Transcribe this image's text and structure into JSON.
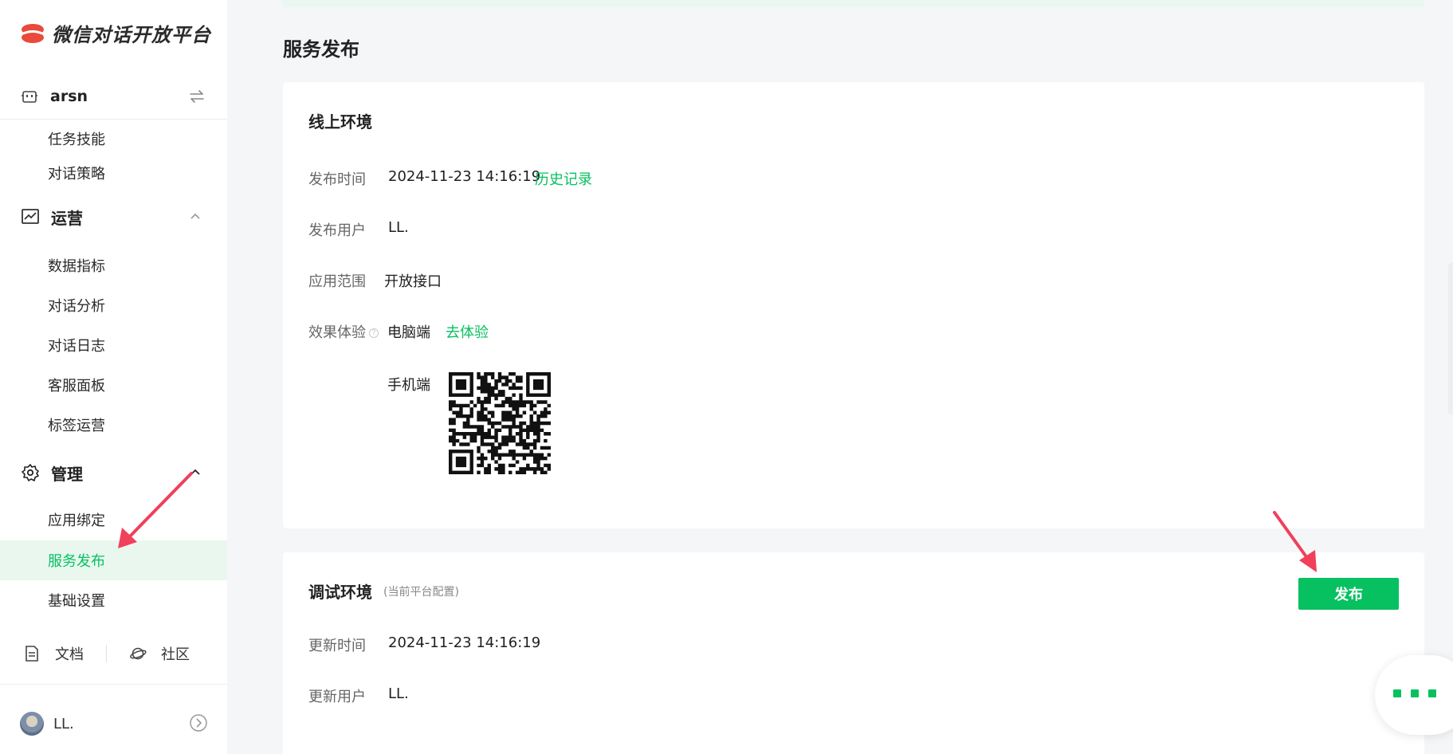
{
  "app": {
    "title": "微信对话开放平台"
  },
  "bot": {
    "name": "arsn"
  },
  "sidebar": {
    "items_top": [
      {
        "label": "任务技能"
      },
      {
        "label": "对话策略"
      }
    ],
    "groups": [
      {
        "label": "运营",
        "icon": "chart-icon",
        "expanded": true,
        "items": [
          {
            "label": "数据指标"
          },
          {
            "label": "对话分析"
          },
          {
            "label": "对话日志"
          },
          {
            "label": "客服面板"
          },
          {
            "label": "标签运营"
          }
        ]
      },
      {
        "label": "管理",
        "icon": "gear-icon",
        "expanded": true,
        "items": [
          {
            "label": "应用绑定"
          },
          {
            "label": "服务发布",
            "active": true
          },
          {
            "label": "基础设置"
          }
        ]
      }
    ],
    "footer": {
      "docs": "文档",
      "community": "社区"
    },
    "user": {
      "name": "LL."
    }
  },
  "page": {
    "title": "服务发布"
  },
  "online": {
    "title": "线上环境",
    "publish_time_label": "发布时间",
    "publish_time": "2024-11-23 14:16:19",
    "history_link": "历史记录",
    "publish_user_label": "发布用户",
    "publish_user": "LL.",
    "scope_label": "应用范围",
    "scope": "开放接口",
    "experience_label": "效果体验",
    "pc_label": "电脑端",
    "pc_link": "去体验",
    "mobile_label": "手机端"
  },
  "debug": {
    "title": "调试环境",
    "note": "(当前平台配置)",
    "publish_button": "发布",
    "update_time_label": "更新时间",
    "update_time": "2024-11-23 14:16:19",
    "update_user_label": "更新用户",
    "update_user": "LL."
  },
  "colors": {
    "accent": "#07c160",
    "logo": "#e94a3b",
    "annotation_arrow": "#f0405a"
  }
}
